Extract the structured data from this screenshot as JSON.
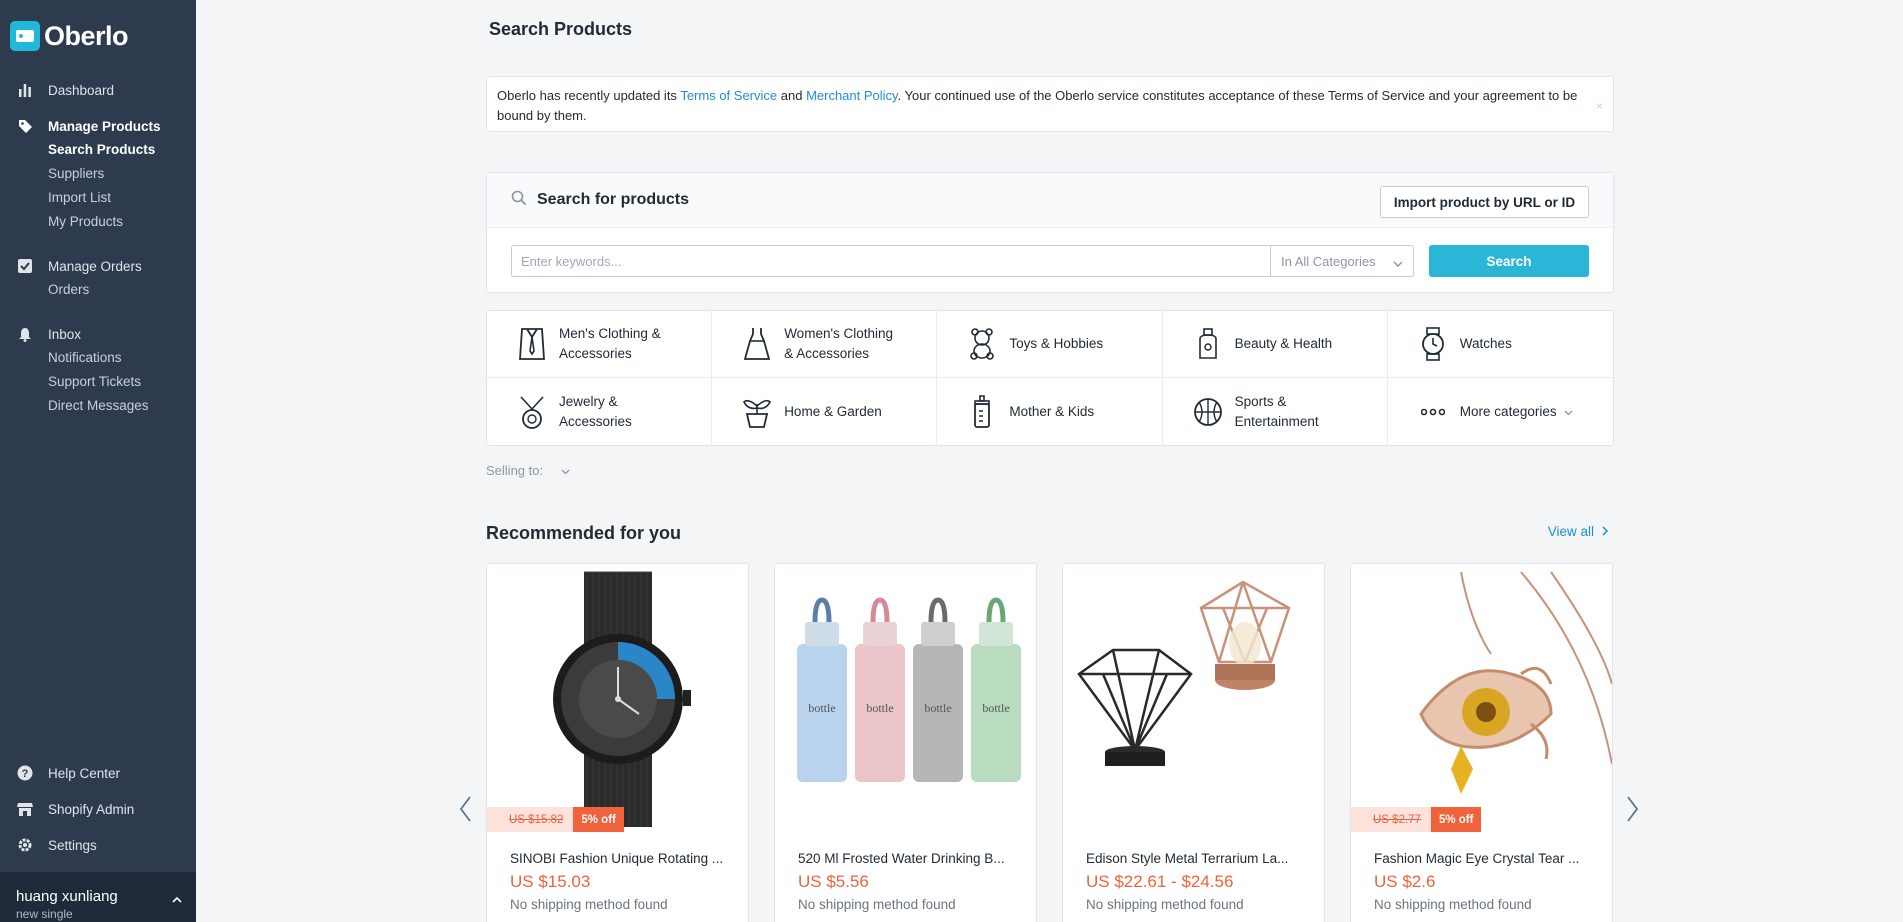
{
  "app": {
    "name": "Oberlo"
  },
  "sidebar": {
    "groups": [
      {
        "label": "Dashboard",
        "icon": "dashboard-icon",
        "items": []
      },
      {
        "label": "Manage Products",
        "icon": "tag-icon",
        "items": [
          "Search Products",
          "Suppliers",
          "Import List",
          "My Products"
        ]
      },
      {
        "label": "Manage Orders",
        "icon": "checkbox-icon",
        "items": [
          "Orders"
        ]
      },
      {
        "label": "Inbox",
        "icon": "bell-icon",
        "items": [
          "Notifications",
          "Support Tickets",
          "Direct Messages"
        ]
      }
    ],
    "bottom": [
      {
        "label": "Help Center",
        "icon": "help-icon"
      },
      {
        "label": "Shopify Admin",
        "icon": "store-icon"
      },
      {
        "label": "Settings",
        "icon": "gear-icon"
      }
    ],
    "user": {
      "name": "huang xunliang",
      "plan": "new single"
    }
  },
  "page": {
    "title": "Search Products"
  },
  "notice": {
    "text_before": "Oberlo has recently updated its ",
    "link1": "Terms of Service",
    "text_mid": " and ",
    "link2": "Merchant Policy",
    "text_after": ". Your continued use of the Oberlo service constitutes acceptance of these Terms of Service and your agreement to be bound by them.",
    "close": "×"
  },
  "search": {
    "heading": "Search for products",
    "import_label": "Import product by URL or ID",
    "placeholder": "Enter keywords...",
    "category_value": "In All Categories",
    "button": "Search"
  },
  "categories": [
    {
      "label": "Men's Clothing & Accessories",
      "icon": "shirt-tie-icon"
    },
    {
      "label": "Women's Clothing & Accessories",
      "icon": "dress-icon"
    },
    {
      "label": "Toys & Hobbies",
      "icon": "teddy-bear-icon"
    },
    {
      "label": "Beauty & Health",
      "icon": "perfume-icon"
    },
    {
      "label": "Watches",
      "icon": "watch-icon"
    },
    {
      "label": "Jewelry & Accessories",
      "icon": "necklace-icon"
    },
    {
      "label": "Home & Garden",
      "icon": "plant-icon"
    },
    {
      "label": "Mother & Kids",
      "icon": "baby-bottle-icon"
    },
    {
      "label": "Sports & Entertainment",
      "icon": "basketball-icon"
    },
    {
      "label": "More categories",
      "icon": "more-icon"
    }
  ],
  "selling_to": {
    "label": "Selling to:"
  },
  "recommended": {
    "title": "Recommended for you",
    "view_all": "View all",
    "products": [
      {
        "title": "SINOBI Fashion Unique Rotating ...",
        "price": "US $15.03",
        "shipping": "No shipping method found",
        "old_price": "US $15.82",
        "off": "5% off",
        "image": "watch"
      },
      {
        "title": "520 Ml Frosted Water Drinking B...",
        "price": "US $5.56",
        "shipping": "No shipping method found",
        "old_price": "",
        "off": "",
        "image": "bottles"
      },
      {
        "title": "Edison Style Metal Terrarium La...",
        "price": "US $22.61 - $24.56",
        "shipping": "No shipping method found",
        "old_price": "",
        "off": "",
        "image": "lamps"
      },
      {
        "title": "Fashion Magic Eye Crystal Tear ...",
        "price": "US $2.6",
        "shipping": "No shipping method found",
        "old_price": "US $2.77",
        "off": "5% off",
        "image": "necklace"
      }
    ]
  },
  "colors": {
    "sidebar": "#2e3b4e",
    "accent": "#2bb6d8",
    "price": "#f0623b",
    "link": "#1f8dd6"
  }
}
